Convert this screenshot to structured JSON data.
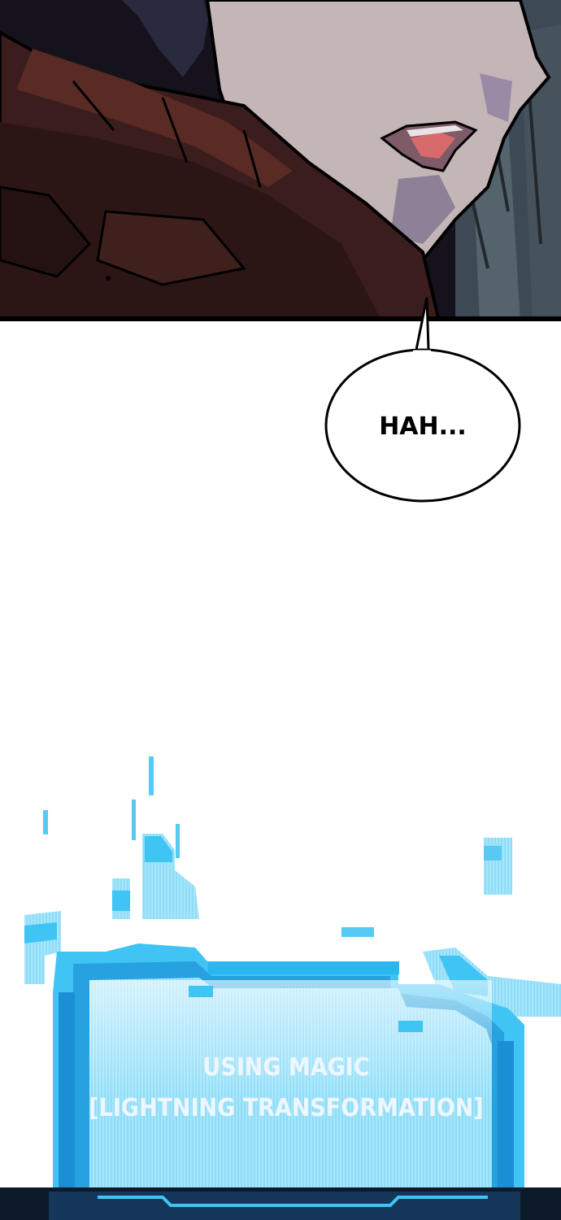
{
  "speech_bubble": {
    "text": "HAH..."
  },
  "system_window": {
    "line1": "USING MAGIC",
    "line2": "[LIGHTNING TRANSFORMATION]"
  },
  "colors": {
    "skin": "#c4b6b7",
    "skin_shadow": "#8c8197",
    "cloak": "#3a1d1c",
    "cloak_light": "#5a2a25",
    "background_dark": "#141118",
    "stone": "#4c5a64",
    "lips": "#d86a6c",
    "magic_light": "#9ee6ff",
    "magic_mid": "#3fc4f4",
    "magic_dark": "#1a8fd6",
    "system_text": "#eef7ff"
  }
}
